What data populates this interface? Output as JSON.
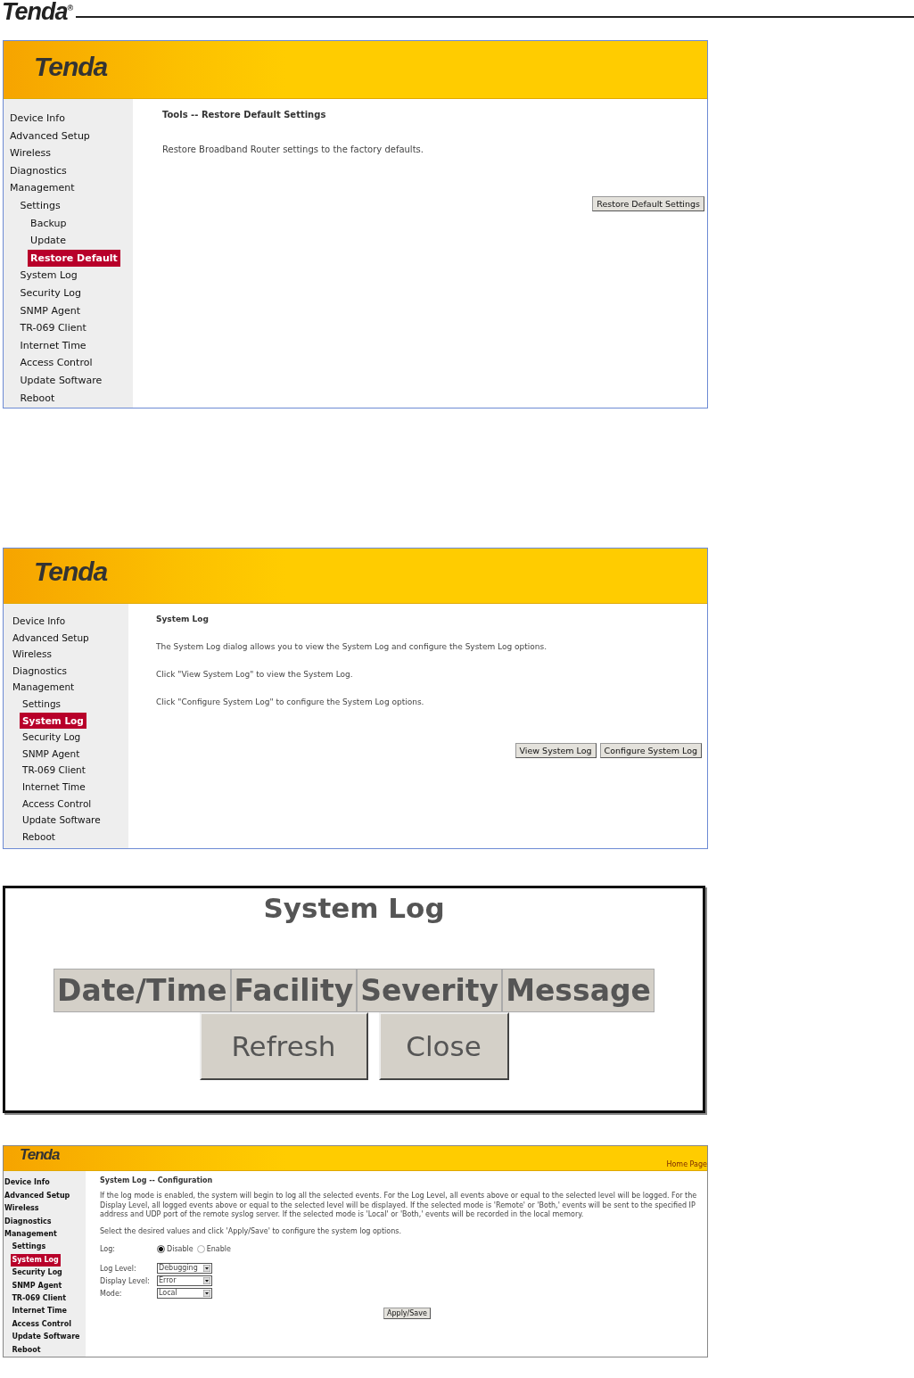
{
  "page_header": {
    "logo": "Tenda",
    "registered": "®"
  },
  "panels": [
    {
      "kind": "router",
      "logo": "Tenda",
      "nav": [
        {
          "label": "Device Info",
          "selected": false
        },
        {
          "label": "Advanced Setup",
          "selected": false
        },
        {
          "label": "Wireless",
          "selected": false
        },
        {
          "label": "Diagnostics",
          "selected": false
        },
        {
          "label": "Management",
          "selected": false,
          "children": [
            {
              "label": "Settings",
              "selected": false,
              "children": [
                {
                  "label": "Backup",
                  "selected": false
                },
                {
                  "label": "Update",
                  "selected": false
                },
                {
                  "label": "Restore Default",
                  "selected": true
                }
              ]
            },
            {
              "label": "System Log",
              "selected": false
            },
            {
              "label": "Security Log",
              "selected": false
            },
            {
              "label": "SNMP Agent",
              "selected": false
            },
            {
              "label": "TR-069 Client",
              "selected": false
            },
            {
              "label": "Internet Time",
              "selected": false
            },
            {
              "label": "Access Control",
              "selected": false
            },
            {
              "label": "Update Software",
              "selected": false
            },
            {
              "label": "Reboot",
              "selected": false
            }
          ]
        }
      ],
      "title": "Tools -- Restore Default Settings",
      "paragraphs": [
        "Restore Broadband Router settings to the factory defaults."
      ],
      "buttons": [
        "Restore Default Settings"
      ]
    },
    {
      "kind": "router",
      "logo": "Tenda",
      "nav": [
        {
          "label": "Device Info",
          "selected": false
        },
        {
          "label": "Advanced Setup",
          "selected": false
        },
        {
          "label": "Wireless",
          "selected": false
        },
        {
          "label": "Diagnostics",
          "selected": false
        },
        {
          "label": "Management",
          "selected": false,
          "children": [
            {
              "label": "Settings",
              "selected": false
            },
            {
              "label": "System Log",
              "selected": true
            },
            {
              "label": "Security Log",
              "selected": false
            },
            {
              "label": "SNMP Agent",
              "selected": false
            },
            {
              "label": "TR-069 Client",
              "selected": false
            },
            {
              "label": "Internet Time",
              "selected": false
            },
            {
              "label": "Access Control",
              "selected": false
            },
            {
              "label": "Update Software",
              "selected": false
            },
            {
              "label": "Reboot",
              "selected": false
            }
          ]
        }
      ],
      "title": "System Log",
      "paragraphs": [
        "The System Log dialog allows you to view the System Log and configure the System Log options.",
        "Click \"View System Log\" to view the System Log.",
        "Click \"Configure System Log\" to configure the System Log options."
      ],
      "buttons": [
        "View System Log",
        "Configure System Log"
      ]
    },
    {
      "kind": "dialog",
      "title": "System Log",
      "columns": [
        "Date/Time",
        "Facility",
        "Severity",
        "Message"
      ],
      "buttons": [
        "Refresh",
        "Close"
      ]
    },
    {
      "kind": "router",
      "logo": "Tenda",
      "home_link": "Home Page",
      "nav": [
        {
          "label": "Device Info",
          "selected": false
        },
        {
          "label": "Advanced Setup",
          "selected": false
        },
        {
          "label": "Wireless",
          "selected": false
        },
        {
          "label": "Diagnostics",
          "selected": false
        },
        {
          "label": "Management",
          "selected": false,
          "children": [
            {
              "label": "Settings",
              "selected": false
            },
            {
              "label": "System Log",
              "selected": true
            },
            {
              "label": "Security Log",
              "selected": false
            },
            {
              "label": "SNMP Agent",
              "selected": false
            },
            {
              "label": "TR-069 Client",
              "selected": false
            },
            {
              "label": "Internet Time",
              "selected": false
            },
            {
              "label": "Access Control",
              "selected": false
            },
            {
              "label": "Update Software",
              "selected": false
            },
            {
              "label": "Reboot",
              "selected": false
            }
          ]
        }
      ],
      "title": "System Log -- Configuration",
      "paragraphs": [
        "If the log mode is enabled, the system will begin to log all the selected events. For the Log Level, all events above or equal to the selected level will be logged. For the Display Level, all logged events above or equal to the selected level will be displayed. If the selected mode is 'Remote' or 'Both,' events will be sent to the specified IP address and UDP port of the remote syslog server. If the selected mode is 'Local' or 'Both,' events will be recorded in the local memory.",
        "Select the desired values and click 'Apply/Save' to configure the system log options."
      ],
      "form": [
        {
          "kind": "radio",
          "label": "Log:",
          "options": [
            {
              "label": "Disable",
              "selected": true
            },
            {
              "label": "Enable",
              "selected": false
            }
          ]
        },
        {
          "kind": "select",
          "label": "Log Level:",
          "value": "Debugging"
        },
        {
          "kind": "select",
          "label": "Display Level:",
          "value": "Error"
        },
        {
          "kind": "select",
          "label": "Mode:",
          "value": "Local"
        }
      ],
      "buttons": [
        "Apply/Save"
      ]
    }
  ]
}
